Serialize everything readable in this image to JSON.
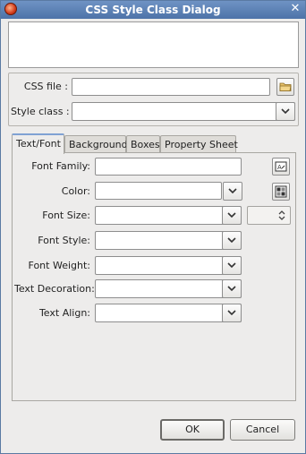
{
  "window": {
    "title": "CSS Style Class Dialog"
  },
  "top": {
    "css_file_label": "CSS file :",
    "css_file_value": "",
    "style_class_label": "Style class :",
    "style_class_value": ""
  },
  "tabs": [
    {
      "label": "Text/Font",
      "active": true
    },
    {
      "label": "Background",
      "active": false
    },
    {
      "label": "Boxes",
      "active": false
    },
    {
      "label": "Property Sheet",
      "active": false
    }
  ],
  "text_font": {
    "font_family_label": "Font Family:",
    "color_label": "Color:",
    "font_size_label": "Font Size:",
    "font_style_label": "Font Style:",
    "font_weight_label": "Font Weight:",
    "text_decoration_label": "Text Decoration:",
    "text_align_label": "Text Align:"
  },
  "buttons": {
    "ok": "OK",
    "cancel": "Cancel"
  },
  "icons": {
    "app": "app-icon",
    "close": "close-icon",
    "folder": "folder-icon",
    "font_chooser": "font-chooser-icon",
    "color_chooser": "color-chooser-icon"
  }
}
